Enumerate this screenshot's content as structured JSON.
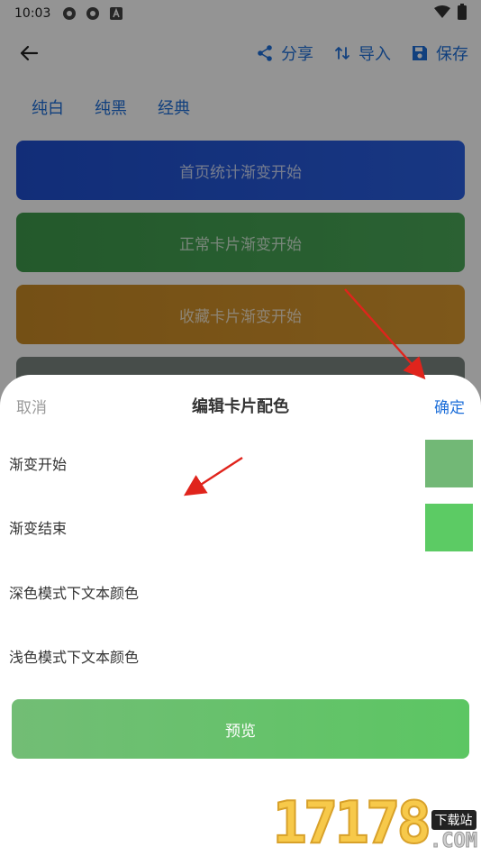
{
  "status_bar": {
    "time": "10:03"
  },
  "toolbar": {
    "share_label": "分享",
    "import_label": "导入",
    "save_label": "保存"
  },
  "presets": [
    "纯白",
    "纯黑",
    "经典"
  ],
  "cards": [
    {
      "label": "首页统计渐变开始"
    },
    {
      "label": "正常卡片渐变开始"
    },
    {
      "label": "收藏卡片渐变开始"
    }
  ],
  "sheet": {
    "cancel_label": "取消",
    "title": "编辑卡片配色",
    "confirm_label": "确定",
    "rows": [
      {
        "label": "渐变开始",
        "color": "#72b876"
      },
      {
        "label": "渐变结束",
        "color": "#5ccb64"
      },
      {
        "label": "深色模式下文本颜色"
      },
      {
        "label": "浅色模式下文本颜色"
      }
    ],
    "preview_label": "预览"
  },
  "colors": {
    "accent": "#1e6fd9",
    "annotation_arrow": "#e0241c"
  },
  "watermark": {
    "number": "17178",
    "tag": "下载站",
    "suffix": ".COM"
  }
}
